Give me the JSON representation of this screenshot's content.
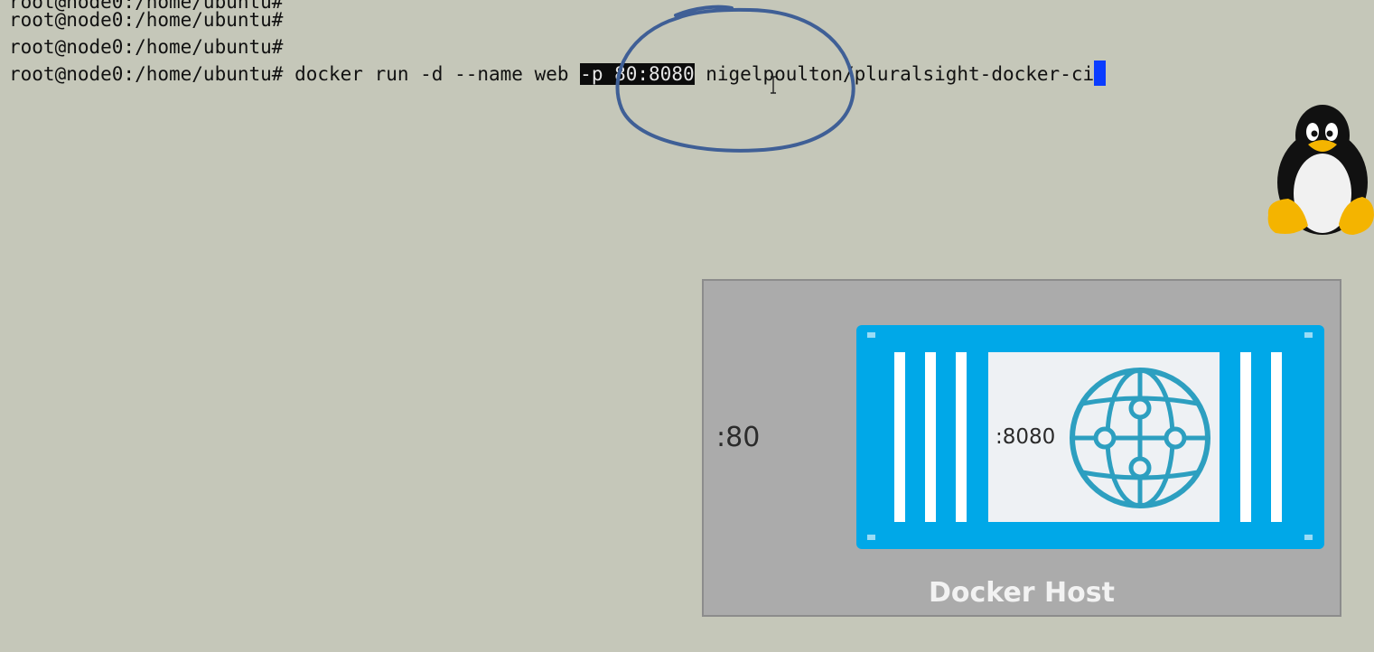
{
  "terminal": {
    "lines": [
      "root@node0:/home/ubuntu#",
      "root@node0:/home/ubuntu#",
      "root@node0:/home/ubuntu#"
    ],
    "command_prompt": "root@node0:/home/ubuntu#",
    "command_before": " docker run -d --name web ",
    "command_highlight": "-p 80:8080",
    "command_after": " nigelpoulton/pluralsight-docker-ci"
  },
  "diagram": {
    "host_port": ":80",
    "container_port": ":8080",
    "host_label": "Docker Host"
  },
  "colors": {
    "background": "#c5c7b9",
    "host_box": "#ababab",
    "container": "#00a8e8",
    "globe": "#2d9fc0",
    "annotation": "#3f5f96",
    "cursor": "#0a3cff"
  },
  "icons": {
    "penguin": "tux-penguin-icon",
    "globe": "globe-network-icon",
    "cursor": "text-ibeam-cursor-icon"
  }
}
